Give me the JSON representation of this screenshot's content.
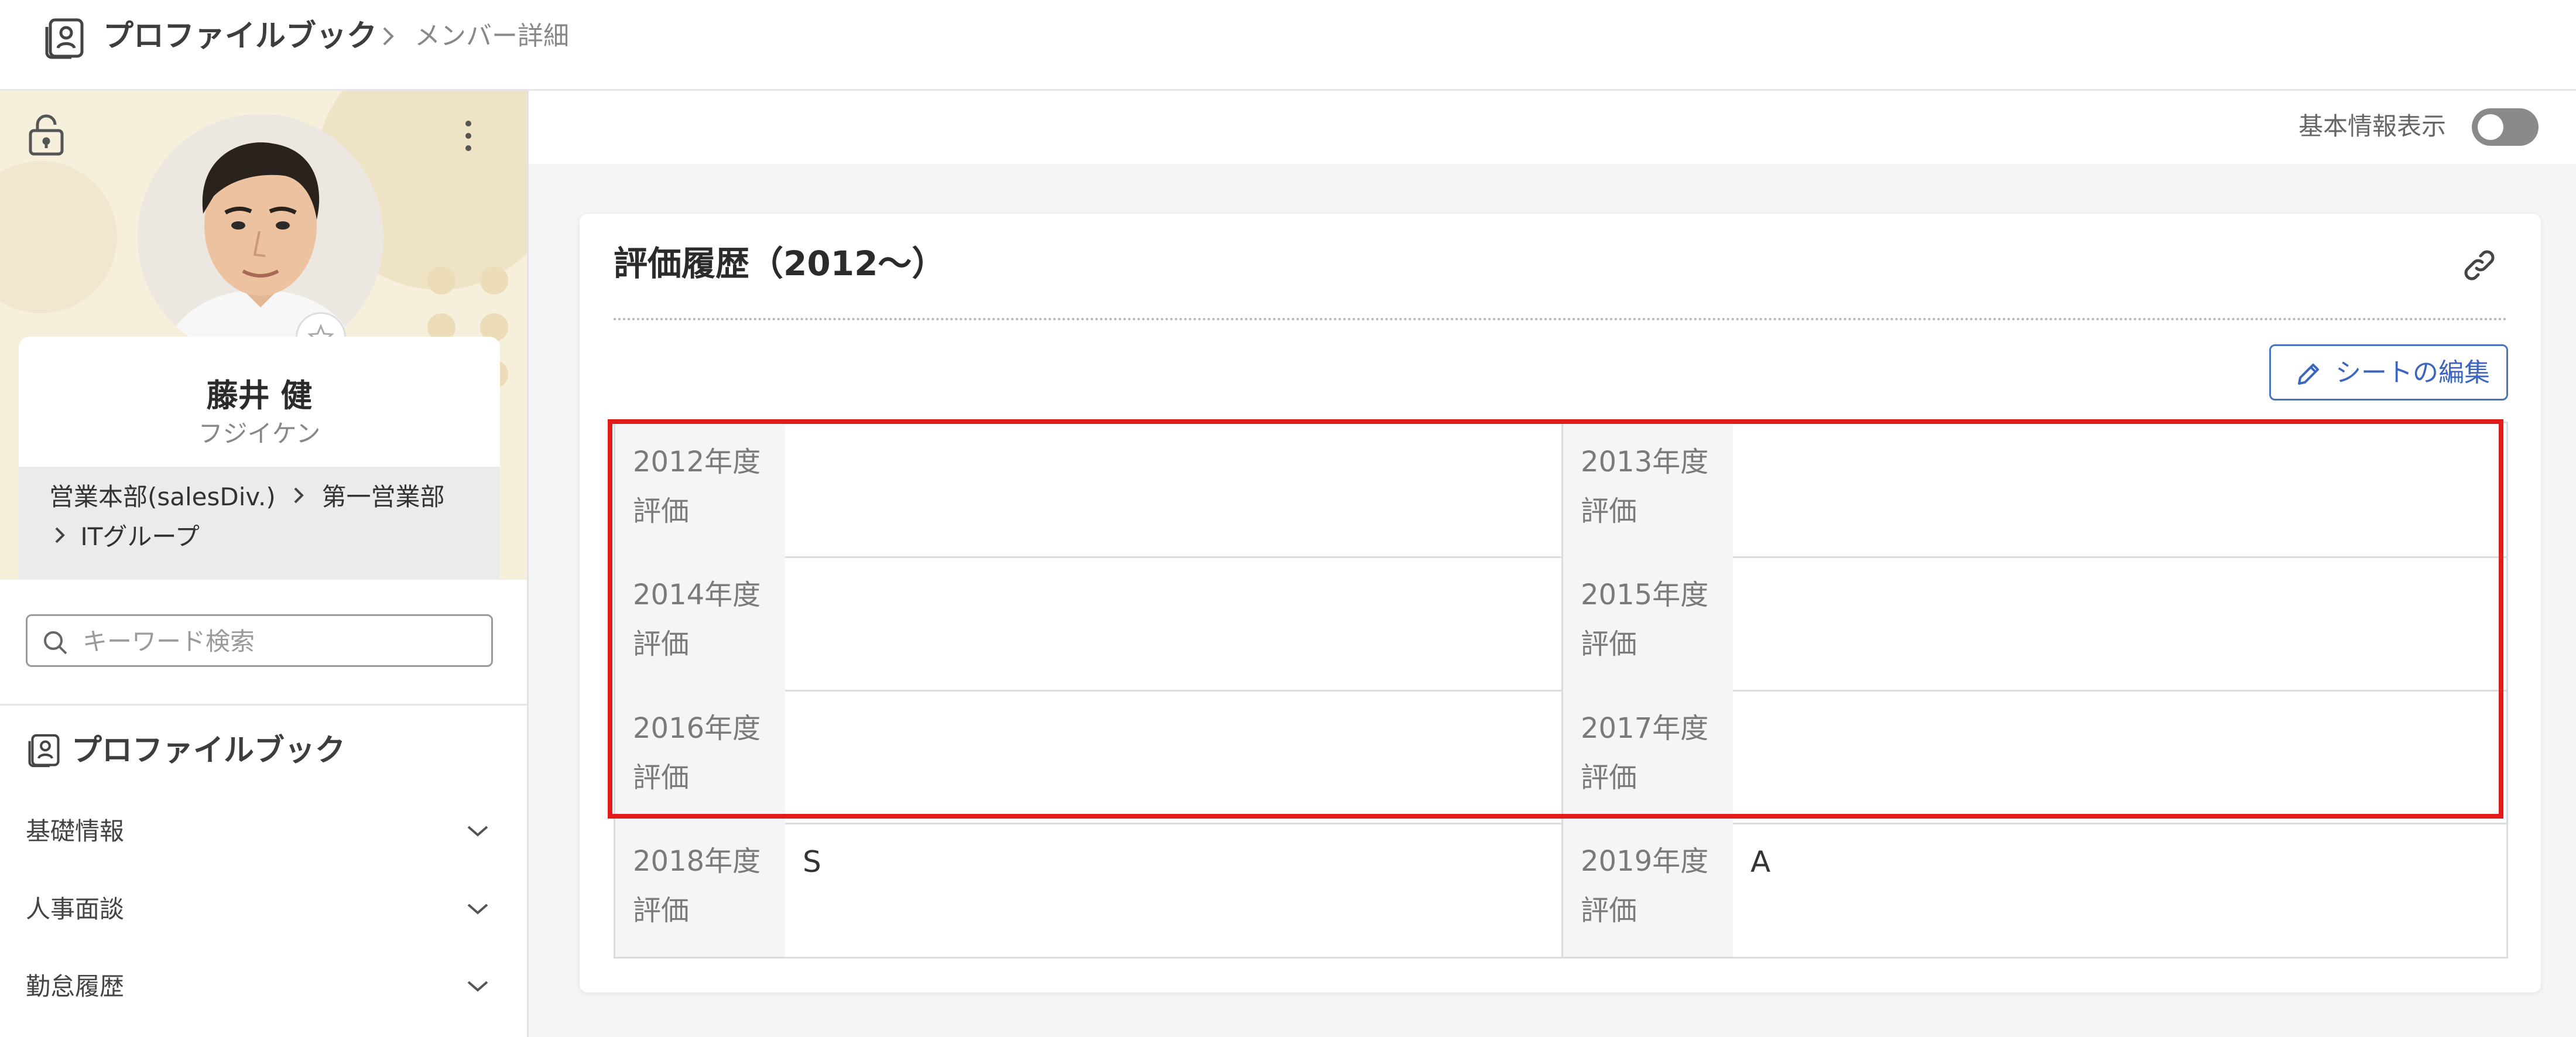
{
  "header": {
    "app_title": "プロファイルブック",
    "breadcrumb_current": "メンバー詳細"
  },
  "profile": {
    "name": "藤井 健",
    "kana": "フジイケン",
    "org": {
      "division": "営業本部(salesDiv.)",
      "department": "第一営業部",
      "group": "ITグループ"
    }
  },
  "search": {
    "placeholder": "キーワード検索",
    "value": ""
  },
  "nav": {
    "heading": "プロファイルブック",
    "items": [
      {
        "label": "基礎情報"
      },
      {
        "label": "人事面談"
      },
      {
        "label": "勤怠履歴"
      }
    ]
  },
  "topbar": {
    "toggle_label": "基本情報表示",
    "toggle_on": false
  },
  "card": {
    "title": "評価履歴（2012～）",
    "edit_button": "シートの編集",
    "rows": [
      [
        {
          "label": "2012年度\n評価",
          "value": ""
        },
        {
          "label": "2013年度\n評価",
          "value": ""
        }
      ],
      [
        {
          "label": "2014年度\n評価",
          "value": ""
        },
        {
          "label": "2015年度\n評価",
          "value": ""
        }
      ],
      [
        {
          "label": "2016年度\n評価",
          "value": ""
        },
        {
          "label": "2017年度\n評価",
          "value": ""
        }
      ],
      [
        {
          "label": "2018年度\n評価",
          "value": "S"
        },
        {
          "label": "2019年度\n評価",
          "value": "A"
        }
      ]
    ]
  },
  "colors": {
    "accent": "#3b66bf",
    "highlight": "#e21b1b",
    "profile_bg": "#f6efdc"
  }
}
